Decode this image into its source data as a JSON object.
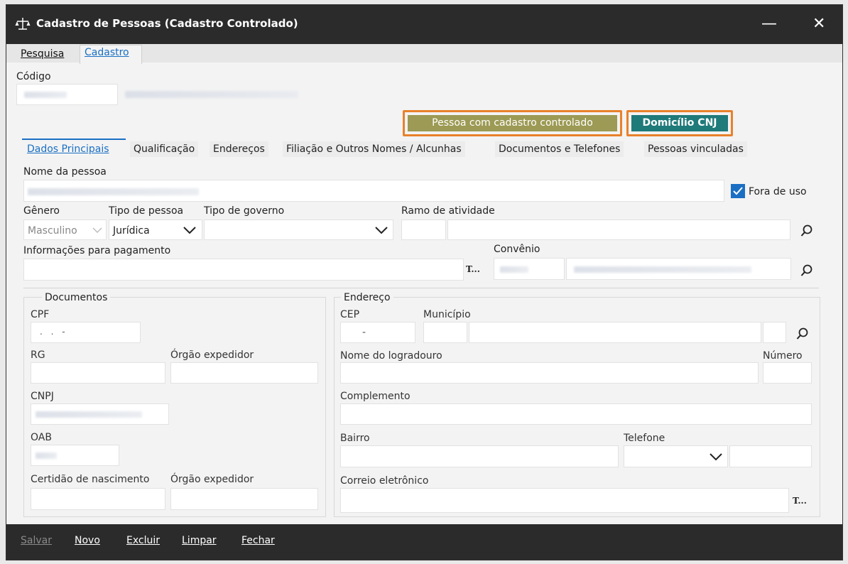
{
  "window": {
    "title": "Cadastro de Pessoas (Cadastro Controlado)",
    "minimize": "—",
    "close": "✕"
  },
  "top_tabs": [
    "Pesquisa",
    "Cadastro"
  ],
  "codigo_label": "Código",
  "buttons": {
    "controlado": "Pessoa com cadastro controlado",
    "domicilio": "Domicílio CNJ"
  },
  "sub_tabs": [
    "Dados Principais",
    "Qualificação",
    "Endereços",
    "Filiação e Outros Nomes / Alcunhas",
    "Documentos e Telefones",
    "Pessoas vinculadas"
  ],
  "fields": {
    "nome_label": "Nome da pessoa",
    "fora_uso": "Fora de uso",
    "genero_label": "Gênero",
    "genero_value": "Masculino",
    "tipo_pessoa_label": "Tipo de pessoa",
    "tipo_pessoa_value": "Jurídica",
    "tipo_governo_label": "Tipo de governo",
    "ramo_label": "Ramo de atividade",
    "info_pag_label": "Informações para pagamento",
    "convenio_label": "Convênio",
    "ellipsis": "T..."
  },
  "documentos": {
    "title": "Documentos",
    "cpf_label": "CPF",
    "cpf_value": ". . -",
    "rg_label": "RG",
    "orgao_label": "Órgão expedidor",
    "cnpj_label": "CNPJ",
    "oab_label": "OAB",
    "certidao_label": "Certidão de nascimento",
    "orgao2_label": "Órgão expedidor"
  },
  "endereco": {
    "title": "Endereço",
    "cep_label": "CEP",
    "cep_value": "-",
    "municipio_label": "Município",
    "logradouro_label": "Nome do logradouro",
    "numero_label": "Número",
    "complemento_label": "Complemento",
    "bairro_label": "Bairro",
    "telefone_label": "Telefone",
    "email_label": "Correio eletrônico"
  },
  "footer": {
    "salvar": "Salvar",
    "novo": "Novo",
    "excluir": "Excluir",
    "limpar": "Limpar",
    "fechar": "Fechar"
  },
  "colors": {
    "accent": "#1a6fc4",
    "olive": "#9c9a54",
    "teal": "#1f7a7a",
    "orange": "#e8812b"
  }
}
